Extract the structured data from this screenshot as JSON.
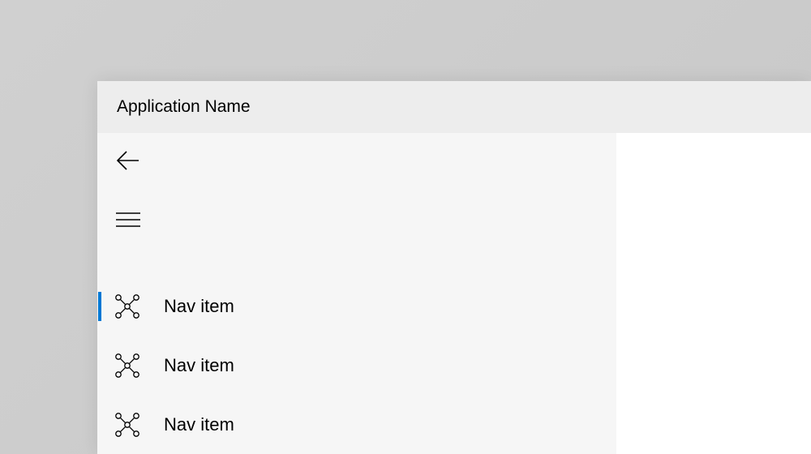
{
  "window": {
    "title": "Application Name"
  },
  "nav": {
    "items": [
      {
        "label": "Nav item",
        "selected": true
      },
      {
        "label": "Nav item",
        "selected": false
      },
      {
        "label": "Nav item",
        "selected": false
      }
    ]
  },
  "colors": {
    "accent": "#0078d4",
    "navBackground": "#f6f6f6",
    "titleBarBackground": "#ededed"
  }
}
